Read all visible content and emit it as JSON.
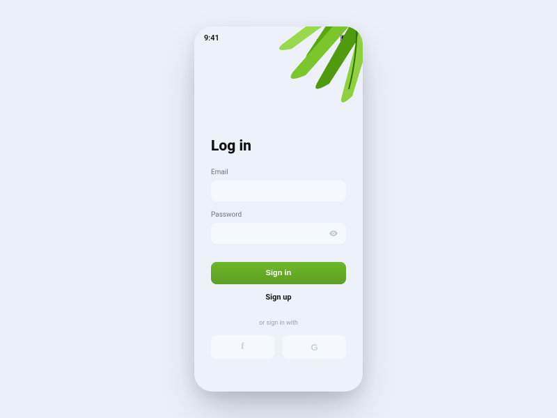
{
  "statusbar": {
    "time": "9:41"
  },
  "screen": {
    "title": "Log in",
    "email_label": "Email",
    "email_value": "",
    "password_label": "Password",
    "password_value": "",
    "signin_label": "Sign in",
    "signup_label": "Sign up",
    "divider": "or sign in with",
    "social": {
      "facebook": "f",
      "google": "G"
    }
  },
  "colors": {
    "accent": "#63a723",
    "background": "#ecf0f8",
    "card": "#edf1f9",
    "input": "#f5f8fd"
  }
}
